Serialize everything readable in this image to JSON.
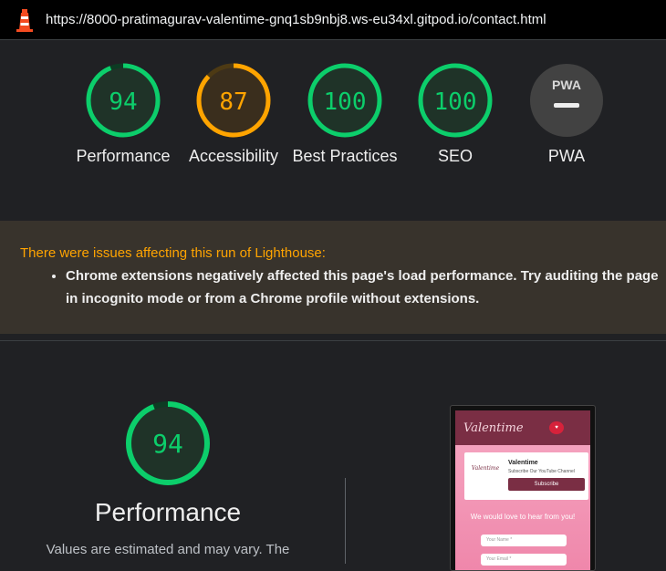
{
  "topbar": {
    "url": "https://8000-pratimagurav-valentime-gnq1sb9nbj8.ws-eu34xl.gitpod.io/contact.html",
    "logo_icon": "lighthouse-icon"
  },
  "colors": {
    "pass": "#0cce6b",
    "average": "#ffa400",
    "gray": "#5f6368"
  },
  "gauges": [
    {
      "label": "Performance",
      "score": "94",
      "value": 94,
      "status": "pass"
    },
    {
      "label": "Accessibility",
      "score": "87",
      "value": 87,
      "status": "average"
    },
    {
      "label": "Best Practices",
      "score": "100",
      "value": 100,
      "status": "pass"
    },
    {
      "label": "SEO",
      "score": "100",
      "value": 100,
      "status": "pass"
    },
    {
      "label": "PWA",
      "badge": "PWA",
      "icon": "pwa-dash-icon"
    }
  ],
  "warning": {
    "title": "There were issues affecting this run of Lighthouse:",
    "items": [
      "Chrome extensions negatively affected this page's load performance. Try auditing the page in incognito mode or from a Chrome profile without extensions."
    ]
  },
  "performance": {
    "score": "94",
    "value": 94,
    "title": "Performance",
    "description": "Values are estimated and may vary. The"
  },
  "preview": {
    "logo": "Valentime",
    "card_brand": "Valentime",
    "card_title": "Valentime",
    "card_subtitle": "Subscribe Our YouTube Channel",
    "card_button": "Subscribe",
    "hero": "We would love to hear from you!",
    "name_placeholder": "Your Name *",
    "email_placeholder": "Your Email *"
  }
}
